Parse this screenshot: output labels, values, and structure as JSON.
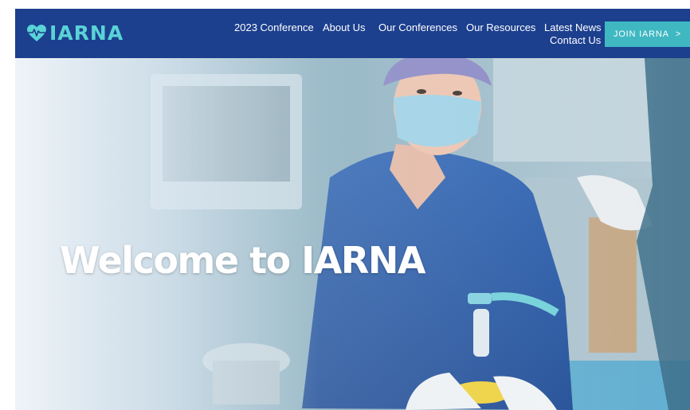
{
  "brand": {
    "name": "IARNA",
    "icon": "heart-pulse-icon",
    "color": "#5ad3d6"
  },
  "nav": {
    "items": [
      {
        "label": "2023 Conference"
      },
      {
        "label": "About Us"
      },
      {
        "label": "Our Conferences"
      },
      {
        "label": "Our Resources"
      },
      {
        "label": "Latest News"
      },
      {
        "label": "Contact Us"
      }
    ],
    "cta": {
      "label": "JOIN IARNA",
      "icon": "chevron-right-icon",
      "glyph": ">"
    }
  },
  "hero": {
    "title": "Welcome to IARNA",
    "image": "nurse-with-anesthesia-mask-photo"
  },
  "colors": {
    "header_bg": "#1c3f8e",
    "accent": "#3fb8c2",
    "text": "#ffffff"
  }
}
